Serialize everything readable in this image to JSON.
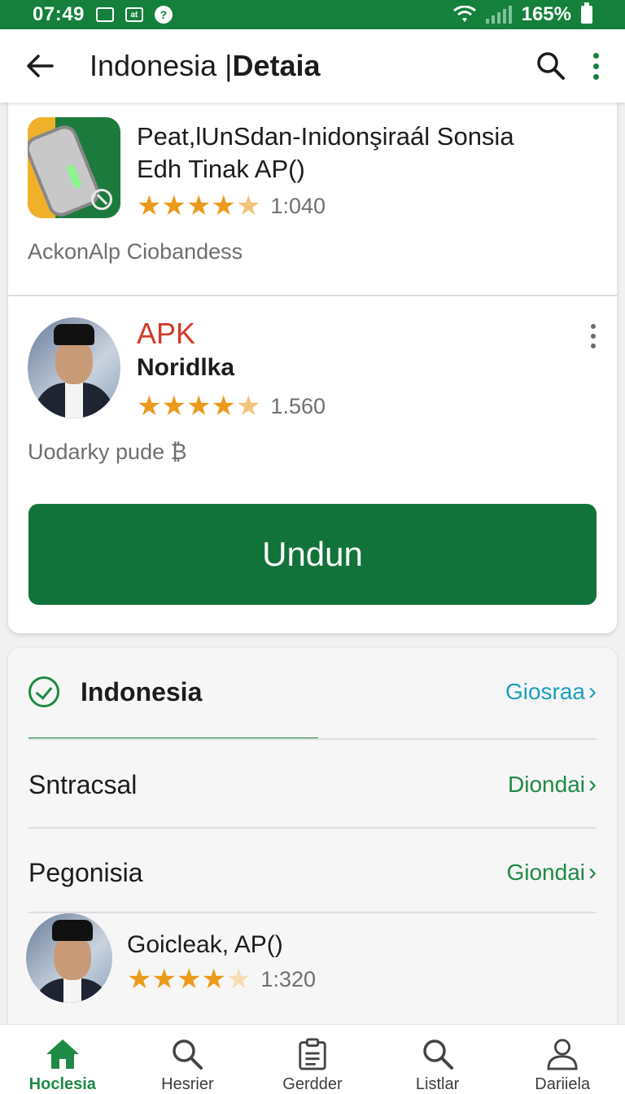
{
  "status_bar": {
    "time": "07:49",
    "icon_a": "",
    "icon_b": "at",
    "icon_c": "?",
    "battery": "165%"
  },
  "app_bar": {
    "title_part1": "Indonesia",
    "title_part2": "Detaia"
  },
  "apps": [
    {
      "title": "Peat,lUnSdan-Inidonşiraál Sonsia",
      "title2": "Edh Tinak AP()",
      "rating_count": "1:040",
      "caption": "AckonAlp Ciobandess",
      "rating": 4.5
    },
    {
      "title": "APK",
      "subtitle": "Noridlka",
      "rating_count": "1.560",
      "caption": "Uodarky pude ₿",
      "rating": 4.5
    }
  ],
  "install_label": "Undun",
  "section": {
    "title": "Indonesia",
    "link": "Giosraa",
    "rows": [
      {
        "label": "Sntracsal",
        "link": "Diondai"
      },
      {
        "label": "Pegonisia",
        "link": "Giondai"
      }
    ]
  },
  "mini_app": {
    "title": "Goicleak, AP()",
    "rating_count": "1:320",
    "rating": 4
  },
  "nav": [
    {
      "label": "Hoclesia",
      "icon": "home-icon"
    },
    {
      "label": "Hesrier",
      "icon": "search-icon"
    },
    {
      "label": "Gerdder",
      "icon": "clipboard-icon"
    },
    {
      "label": "Listlar",
      "icon": "search-icon"
    },
    {
      "label": "Dariiela",
      "icon": "person-icon"
    }
  ],
  "colors": {
    "primary": "#14803c",
    "accent_red": "#d23a26",
    "link_blue": "#1b9fbd",
    "star": "#ec9a1b"
  }
}
